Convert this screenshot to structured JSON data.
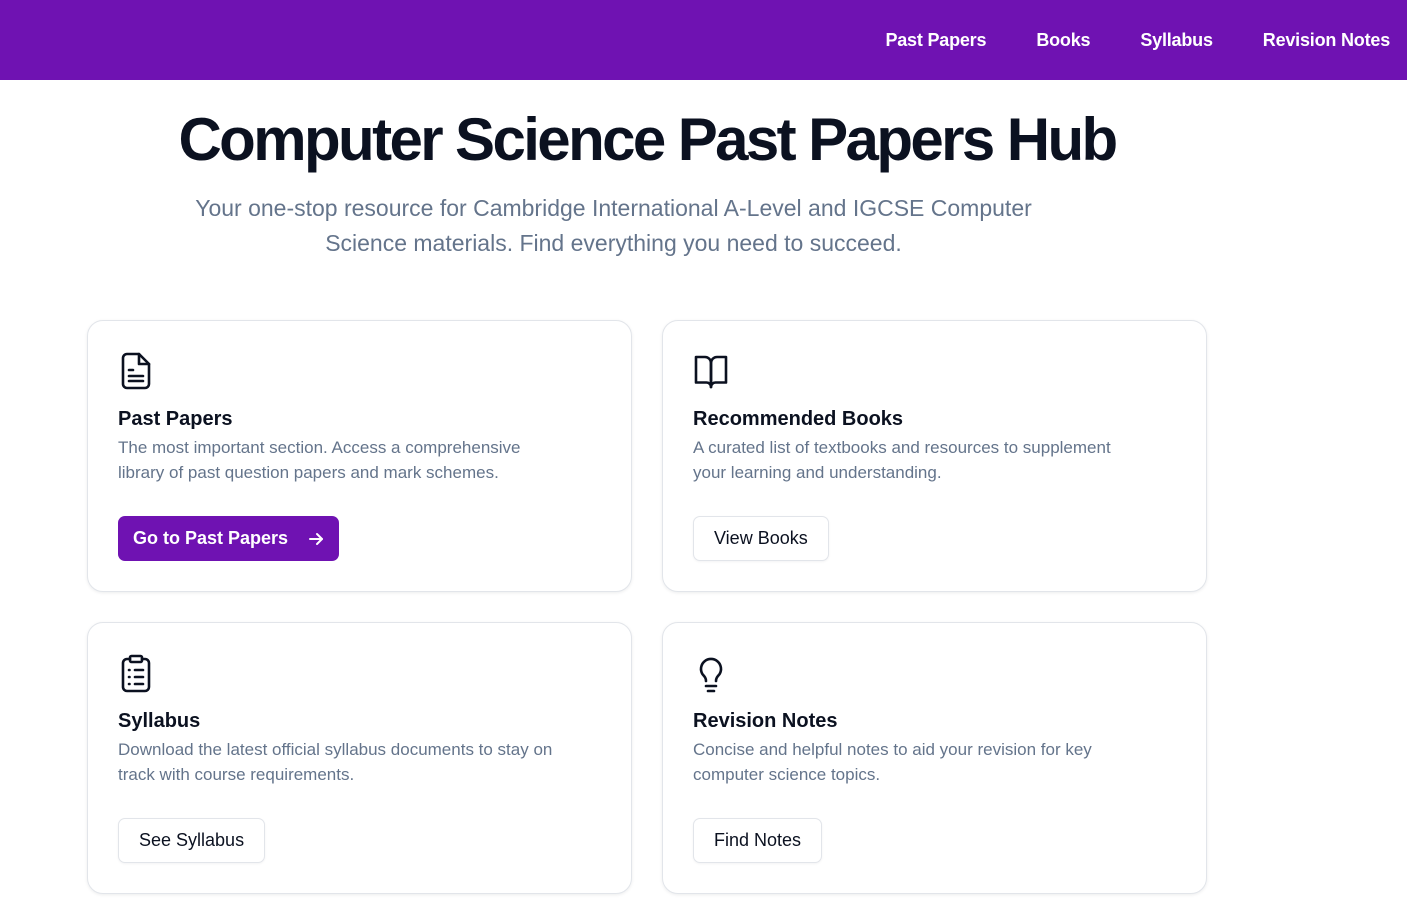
{
  "nav": {
    "items": [
      "Past Papers",
      "Books",
      "Syllabus",
      "Revision Notes"
    ]
  },
  "hero": {
    "title": "Computer Science Past Papers Hub",
    "subtitle_line1": "Your one-stop resource for Cambridge International A-Level and IGCSE Computer",
    "subtitle_line2": "Science materials. Find everything you need to succeed."
  },
  "cards": [
    {
      "icon": "document-icon",
      "title": "Past Papers",
      "desc_line1": "The most important section. Access a comprehensive",
      "desc_line2": "library of past question papers and mark schemes.",
      "button": "Go to Past Papers"
    },
    {
      "icon": "book-open-icon",
      "title": "Recommended Books",
      "desc_line1": "A curated list of textbooks and resources to supplement",
      "desc_line2": "your learning and understanding.",
      "button": "View Books"
    },
    {
      "icon": "clipboard-list-icon",
      "title": "Syllabus",
      "desc_line1": "Download the latest official syllabus documents to stay on",
      "desc_line2": "track with course requirements.",
      "button": "See Syllabus"
    },
    {
      "icon": "lightbulb-icon",
      "title": "Revision Notes",
      "desc_line1": "Concise and helpful notes to aid your revision for key",
      "desc_line2": "computer science topics.",
      "button": "Find Notes"
    }
  ],
  "colors": {
    "brand": "#6f12b2",
    "heading": "#0b1120",
    "muted": "#64748b",
    "border": "#e2e5ea"
  }
}
